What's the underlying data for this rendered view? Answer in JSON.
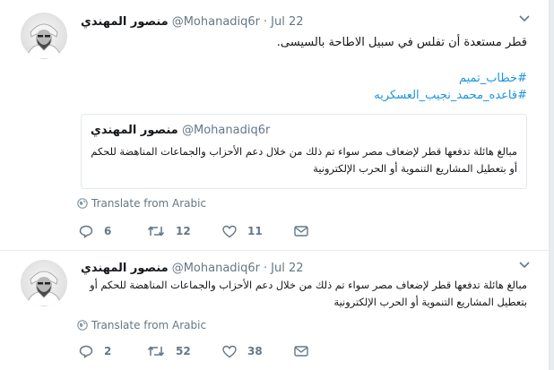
{
  "tweets": [
    {
      "author_name": "منصور المهندي",
      "handle": "@Mohanadiq6r",
      "dot": "·",
      "date": "Jul 22",
      "text": "قطر مستعدة أن تفلس في سبيل الاطاحة بالسيسى.",
      "hashtags": [
        "#خطاب_تميم",
        "#قاعده_محمد_نجيب_العسكريه"
      ],
      "quote": {
        "author_name": "منصور المهندي",
        "handle": "@Mohanadiq6r",
        "text": "مبالغ هائلة تدفعها قطر لإضعاف مصر سواء تم ذلك من خلال دعم الأحزاب والجماعات المناهضة للحكم أو بتعطيل المشاريع التنموية أو الحرب الإلكترونية"
      },
      "translate_label": "Translate from Arabic",
      "replies": "6",
      "retweets": "12",
      "likes": "11"
    },
    {
      "author_name": "منصور المهندي",
      "handle": "@Mohanadiq6r",
      "dot": "·",
      "date": "Jul 22",
      "text": "مبالغ هائلة تدفعها قطر لإضعاف مصر سواء تم ذلك من خلال دعم الأحزاب والجماعات المناهضة للحكم أو بتعطيل المشاريع التنموية أو الحرب الإلكترونية",
      "translate_label": "Translate from Arabic",
      "replies": "2",
      "retweets": "52",
      "likes": "38"
    }
  ],
  "colors": {
    "link": "#1b95e0",
    "muted": "#657786",
    "text": "#14171a",
    "border": "#e6ecf0"
  },
  "icons": [
    "avatar",
    "chevron-down-icon",
    "globe-icon",
    "reply-icon",
    "retweet-icon",
    "like-icon",
    "direct-message-icon"
  ]
}
